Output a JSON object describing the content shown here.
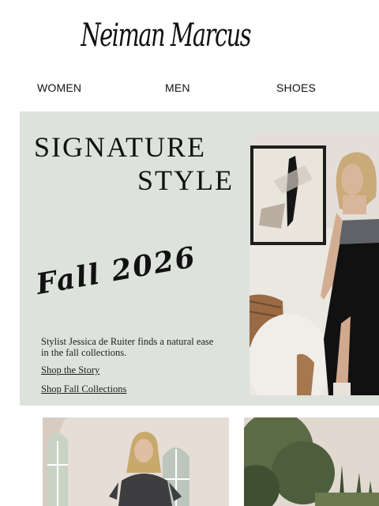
{
  "brand": {
    "logo_text": "Neiman Marcus"
  },
  "nav": {
    "items": [
      "WOMEN",
      "MEN",
      "SHOES"
    ]
  },
  "hero": {
    "headline_line1": "SIGNATURE",
    "headline_line2": "STYLE",
    "script_title": "Fall 2026",
    "description": "Stylist Jessica de Ruiter finds a natural ease in the fall collections.",
    "link_story": "Shop the Story",
    "link_collections": "Shop Fall Collections",
    "bg_color": "#dde2dc"
  }
}
